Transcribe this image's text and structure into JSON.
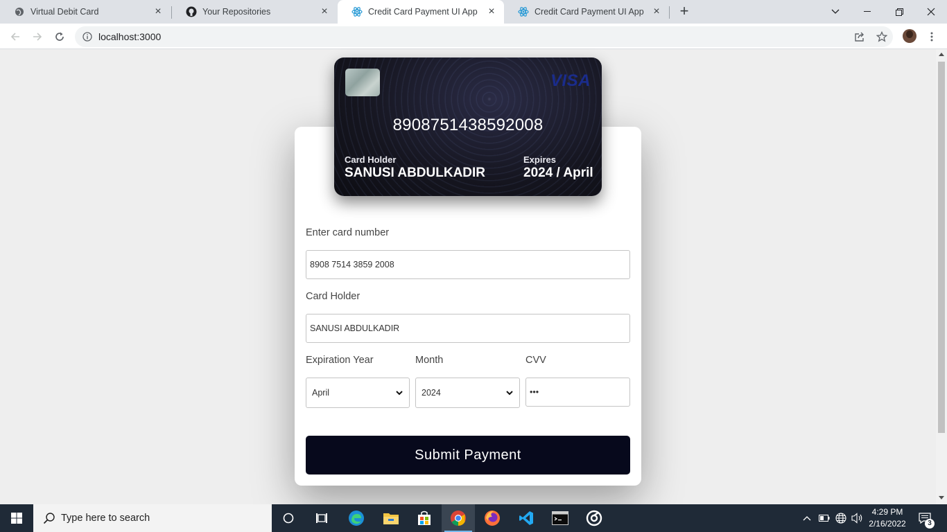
{
  "browser": {
    "tabs": [
      {
        "title": "Virtual Debit Card",
        "icon": "globe-icon",
        "active": false
      },
      {
        "title": "Your Repositories",
        "icon": "github-icon",
        "active": false
      },
      {
        "title": "Credit Card Payment UI App",
        "icon": "react-icon",
        "active": true
      },
      {
        "title": "Credit Card Payment UI App",
        "icon": "react-icon",
        "active": false
      }
    ],
    "address": "localhost:3000"
  },
  "card": {
    "brand": "VISA",
    "number": "8908751438592008",
    "holder_label": "Card Holder",
    "holder": "SANUSI ABDULKADIR",
    "expires_label": "Expires",
    "expires": "2024 / April"
  },
  "form": {
    "card_number_label": "Enter card number",
    "card_number_value": "8908 7514 3859 2008",
    "holder_label": "Card Holder",
    "holder_value": "SANUSI ABDULKADIR",
    "exp_year_label": "Expiration Year",
    "exp_year_selected": "April",
    "month_label": "Month",
    "month_selected": "2024",
    "cvv_label": "CVV",
    "cvv_value": "•••",
    "submit_label": "Submit Payment"
  },
  "taskbar": {
    "search_placeholder": "Type here to search",
    "time": "4:29 PM",
    "date": "2/16/2022",
    "notification_count": "3"
  },
  "colors": {
    "submit_bg": "#07091c",
    "page_bg": "#eeeeee",
    "taskbar_bg": "#1f2a37"
  }
}
